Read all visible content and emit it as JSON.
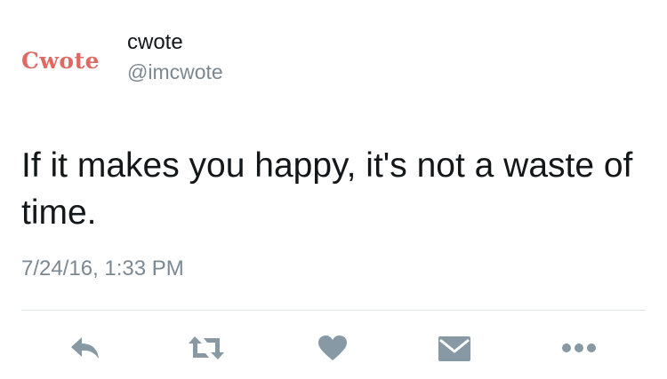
{
  "author": {
    "avatar_text": "Cwote",
    "display_name": "cwote",
    "handle": "@imcwote"
  },
  "tweet": {
    "text": "If it makes you happy, it's not a waste of time.",
    "timestamp": "7/24/16, 1:33 PM"
  },
  "actions": [
    {
      "name": "reply",
      "icon": "reply-icon"
    },
    {
      "name": "retweet",
      "icon": "retweet-icon"
    },
    {
      "name": "like",
      "icon": "heart-icon"
    },
    {
      "name": "message",
      "icon": "envelope-icon"
    },
    {
      "name": "more",
      "icon": "more-dots-icon"
    }
  ],
  "colors": {
    "avatar_text": "#e06a63",
    "text": "#14171a",
    "secondary": "#7b8892",
    "icon": "#8899a6",
    "divider": "#dde2e6"
  }
}
